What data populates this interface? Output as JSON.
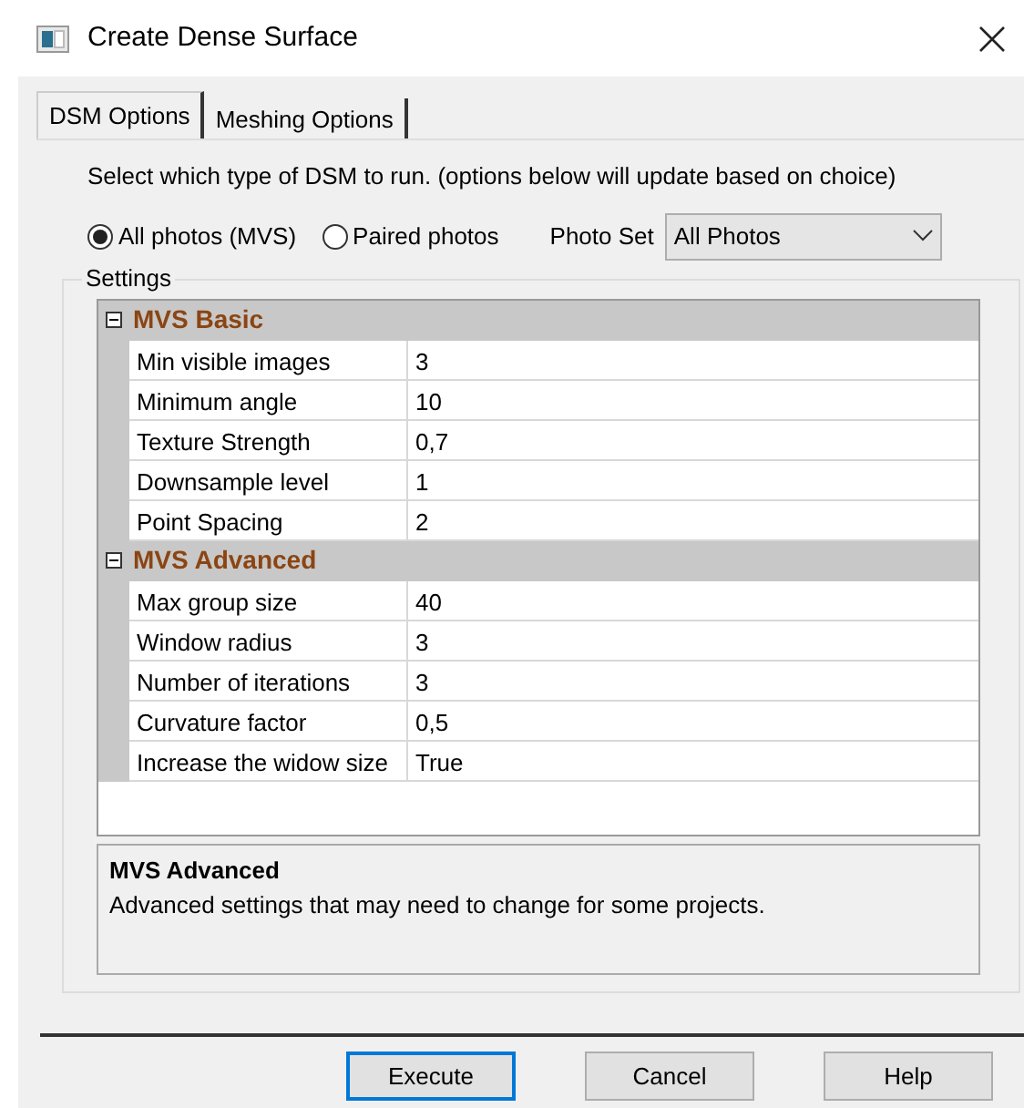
{
  "window": {
    "title": "Create Dense Surface"
  },
  "tabs": [
    {
      "label": "DSM Options",
      "selected": true
    },
    {
      "label": "Meshing Options",
      "selected": false
    }
  ],
  "instruction": "Select which type of DSM to run.  (options below will update based on choice)",
  "dsm_type": [
    {
      "label": "All photos (MVS)",
      "selected": true
    },
    {
      "label": "Paired photos",
      "selected": false
    }
  ],
  "photo_set": {
    "label": "Photo Set",
    "value": "All Photos"
  },
  "settings": {
    "title": "Settings",
    "categories": [
      {
        "name": "MVS Basic",
        "expanded": true,
        "properties": [
          {
            "name": "Min visible images",
            "value": "3"
          },
          {
            "name": "Minimum angle",
            "value": "10"
          },
          {
            "name": "Texture Strength",
            "value": "0,7"
          },
          {
            "name": "Downsample level",
            "value": "1"
          },
          {
            "name": "Point Spacing",
            "value": "2"
          }
        ]
      },
      {
        "name": "MVS Advanced",
        "expanded": true,
        "properties": [
          {
            "name": "Max group size",
            "value": "40"
          },
          {
            "name": "Window radius",
            "value": "3"
          },
          {
            "name": "Number of iterations",
            "value": "3"
          },
          {
            "name": "Curvature factor",
            "value": "0,5"
          },
          {
            "name": "Increase the widow size",
            "value": "True"
          }
        ]
      }
    ],
    "description": {
      "title": "MVS Advanced",
      "text": "Advanced settings that may need to change for some projects."
    }
  },
  "buttons": [
    {
      "label": "Execute",
      "default": true
    },
    {
      "label": "Cancel",
      "default": false
    },
    {
      "label": "Help",
      "default": false
    }
  ]
}
